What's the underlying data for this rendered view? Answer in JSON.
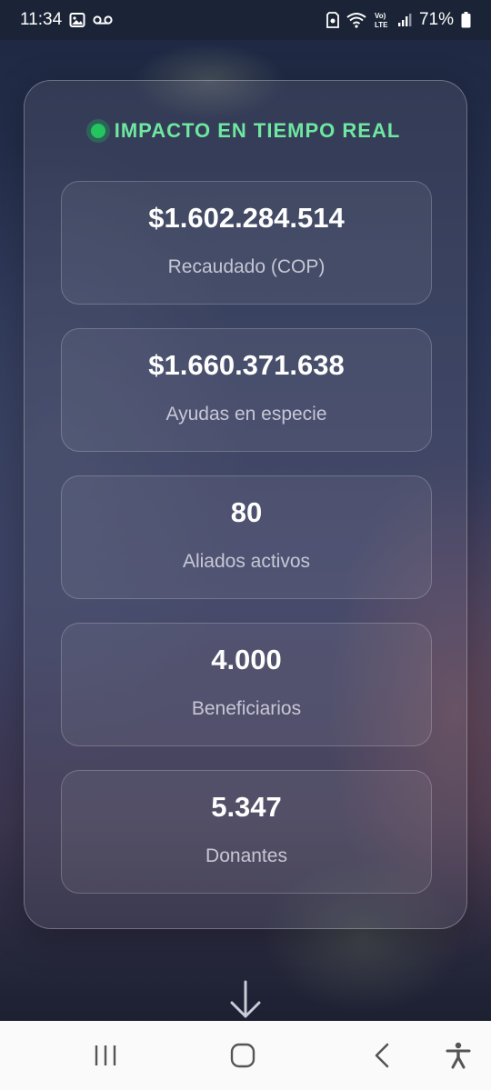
{
  "status_bar": {
    "time": "11:34",
    "battery": "71%",
    "icons": [
      "image-icon",
      "voicemail-icon",
      "sim-alert-icon",
      "wifi-icon",
      "volte-icon",
      "signal-icon",
      "battery-icon"
    ]
  },
  "card": {
    "title": "IMPACTO EN TIEMPO REAL",
    "live_color": "#22c55e",
    "stats": [
      {
        "value": "$1.602.284.514",
        "label": "Recaudado (COP)"
      },
      {
        "value": "$1.660.371.638",
        "label": "Ayudas en especie"
      },
      {
        "value": "80",
        "label": "Aliados activos"
      },
      {
        "value": "4.000",
        "label": "Beneficiarios"
      },
      {
        "value": "5.347",
        "label": "Donantes"
      }
    ]
  },
  "scroll_hint": {
    "icon": "arrow-down-icon"
  },
  "nav_bar": {
    "buttons": [
      "recent-apps-icon",
      "home-icon",
      "back-icon",
      "accessibility-icon"
    ]
  }
}
